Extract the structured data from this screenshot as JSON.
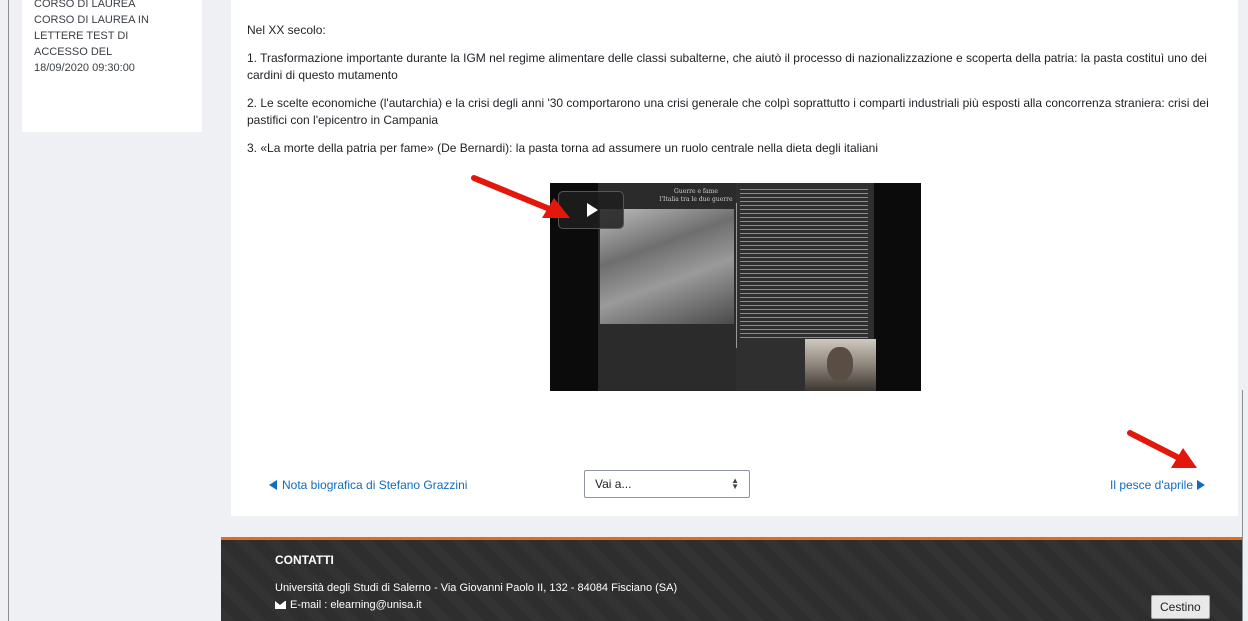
{
  "sidebar": {
    "lines": [
      "CORSO DI LAUREA",
      "CORSO DI LAUREA IN",
      "LETTERE TEST DI",
      "ACCESSO del",
      "18/09/2020 09:30:00"
    ]
  },
  "content": {
    "heading": "Nel XX secolo:",
    "paragraphs": [
      "1. Trasformazione importante durante la IGM nel regime alimentare delle classi subalterne, che aiutò il processo di nazionalizzazione e scoperta della patria: la pasta costituì uno dei cardini di questo mutamento",
      "2. Le scelte economiche (l'autarchia) e la crisi degli anni '30 comportarono una crisi generale che colpì soprattutto i comparti industriali più esposti alla concorrenza straniera: crisi dei pastifici con l'epicentro in  Campania",
      "3. «La morte della patria per fame» (De Bernardi): la pasta torna ad assumere un ruolo centrale nella dieta degli italiani"
    ],
    "video": {
      "slide_title": "Guerre e fame\nl'Italia tra le due guerre",
      "play_icon": "play-icon"
    }
  },
  "navigation": {
    "prev_label": "Nota biografica di Stefano Grazzini",
    "jump_label": "Vai a...",
    "next_label": "Il pesce d'aprile"
  },
  "footer": {
    "title": "CONTATTI",
    "address": "Università degli Studi di Salerno - Via Giovanni Paolo II, 132 - 84084 Fisciano (SA)",
    "email": "E-mail : elearning@unisa.it",
    "accent_color": "#e66a1d"
  },
  "tooltip": {
    "text": "Cestino"
  },
  "annotations": {
    "arrow_color": "#e3170a"
  }
}
